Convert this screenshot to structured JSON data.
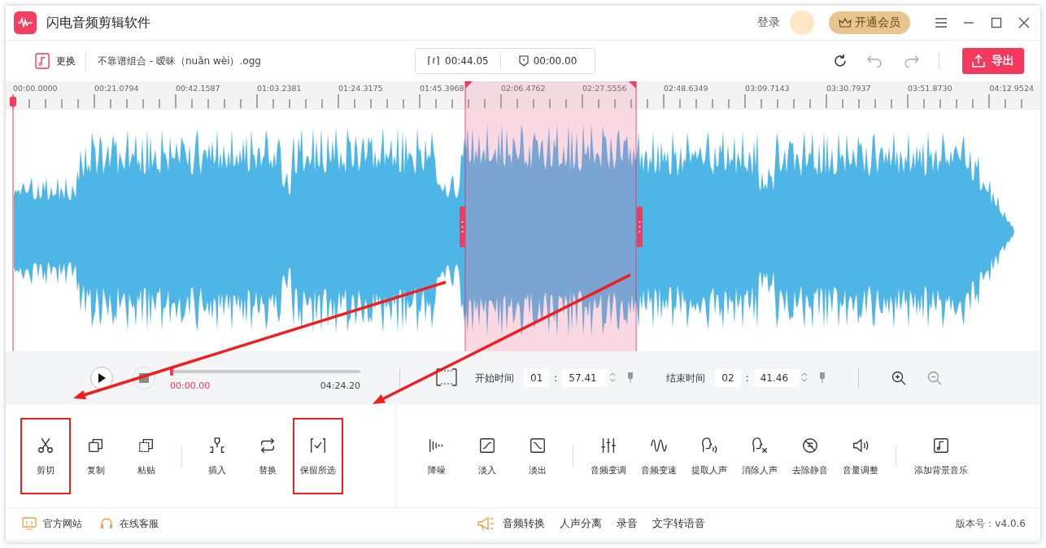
{
  "app": {
    "title": "闪电音频剪辑软件"
  },
  "header": {
    "login": "登录",
    "vip_button": "开通会员"
  },
  "toolbar": {
    "replace_button": "更换",
    "file_name": "不靠谱组合 - 暧昧（nuǎn wèi）.ogg",
    "clip_duration": "00:44.05",
    "mark_time": "00:00.00",
    "export_button": "导出"
  },
  "ruler": {
    "labels": [
      "00:00.0000",
      "00:21.0794",
      "00:42.1587",
      "01:03.2381",
      "01:24.3175",
      "01:45.3968",
      "02:06.4762",
      "02:27.5556",
      "02:48.6349",
      "03:09.7143",
      "03:30.7937",
      "03:51.8730",
      "04:12.9524"
    ]
  },
  "transport": {
    "playback": {
      "level": 0,
      "current": "00:00.00",
      "total": "04:24.20"
    },
    "start": {
      "label": "开始时间",
      "minutes": "01",
      "separator": ":",
      "seconds": "57.41"
    },
    "end": {
      "label": "结束时间",
      "minutes": "02",
      "separator": ":",
      "seconds": "41.46"
    }
  },
  "panels": [
    {
      "groups": [
        [
          {
            "kind": "cut",
            "label": "剪切",
            "highlighted": true
          },
          {
            "kind": "copy",
            "label": "复制",
            "highlighted": false
          },
          {
            "kind": "paste",
            "label": "粘贴",
            "highlighted": false
          }
        ],
        [
          {
            "kind": "insert",
            "label": "插入",
            "highlighted": false
          },
          {
            "kind": "replace",
            "label": "替换",
            "highlighted": false
          },
          {
            "kind": "keep",
            "label": "保留所选",
            "highlighted": true
          }
        ]
      ]
    },
    {
      "groups": [
        [
          {
            "kind": "denoise",
            "label": "降噪",
            "highlighted": false
          },
          {
            "kind": "fadein",
            "label": "淡入",
            "highlighted": false
          },
          {
            "kind": "fadeout",
            "label": "淡出",
            "highlighted": false
          }
        ],
        [
          {
            "kind": "pitch",
            "label": "音频变调",
            "highlighted": false
          },
          {
            "kind": "speed",
            "label": "音频变速",
            "highlighted": false
          },
          {
            "kind": "extract",
            "label": "提取人声",
            "highlighted": false
          },
          {
            "kind": "remove",
            "label": "消除人声",
            "highlighted": false
          },
          {
            "kind": "silence",
            "label": "去除静音",
            "highlighted": false
          },
          {
            "kind": "volume",
            "label": "音量调整",
            "highlighted": false
          }
        ],
        [
          {
            "kind": "bgm",
            "label": "添加背景音乐",
            "highlighted": false
          }
        ]
      ]
    }
  ],
  "footer": {
    "left": [
      {
        "kind": "web",
        "label": "官方网站"
      },
      {
        "kind": "service",
        "label": "在线客服"
      }
    ],
    "center": [
      "音频转换",
      "人声分离",
      "录音",
      "文字转语音"
    ],
    "version": "版本号：v4.0.6"
  }
}
